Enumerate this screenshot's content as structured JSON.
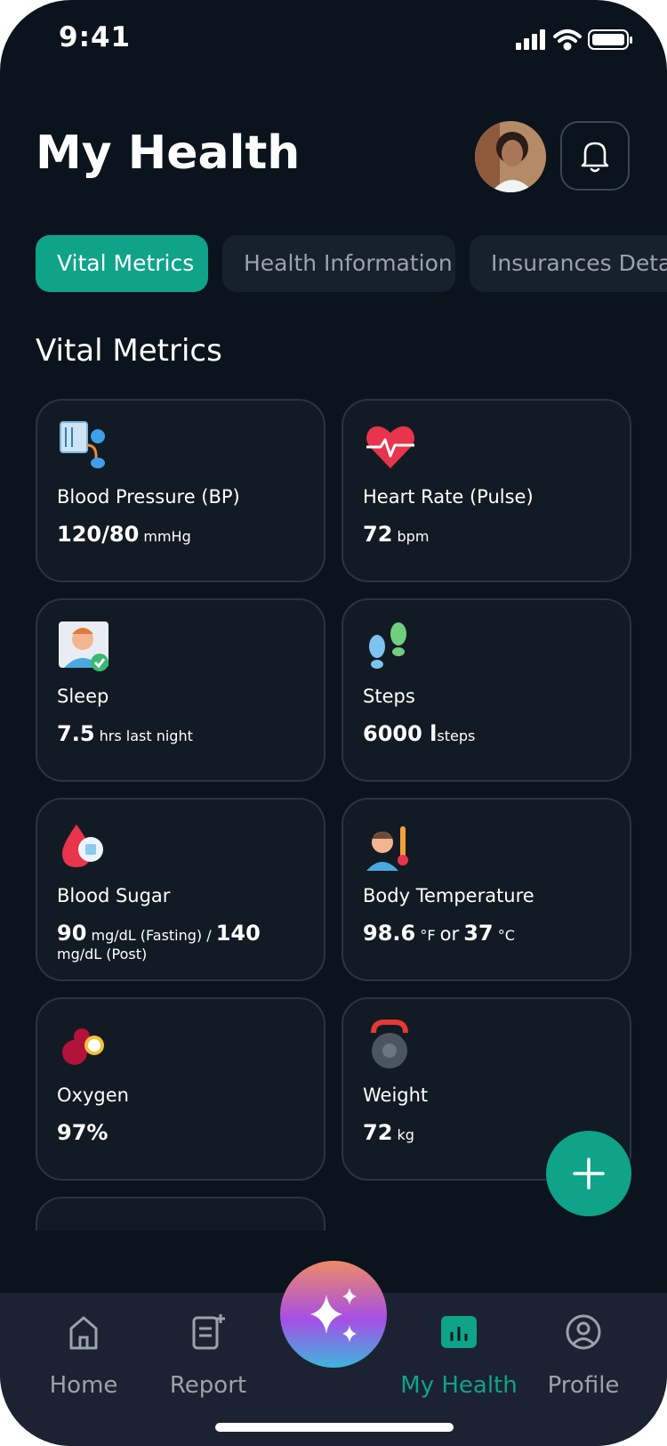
{
  "status": {
    "time": "9:41"
  },
  "header": {
    "title": "My Health"
  },
  "tabs": [
    {
      "label": "Vital Metrics",
      "active": true
    },
    {
      "label": "Health Information",
      "active": false
    },
    {
      "label": "Insurances Details",
      "active": false
    }
  ],
  "section": {
    "title": "Vital Metrics"
  },
  "cards": [
    {
      "icon": "blood-pressure-icon",
      "label": "Blood Pressure (BP)",
      "v1": "120/80",
      "u1": "mmHg"
    },
    {
      "icon": "heart-rate-icon",
      "label": "Heart Rate (Pulse)",
      "v1": "72",
      "u1": "bpm"
    },
    {
      "icon": "sleep-icon",
      "label": "Sleep",
      "v1": "7.5",
      "u1": "hrs last night"
    },
    {
      "icon": "steps-icon",
      "label": "Steps",
      "v1": "6000 l",
      "u1": "steps"
    },
    {
      "icon": "blood-sugar-icon",
      "label": "Blood Sugar",
      "v1": "90",
      "u1": "mg/dL (Fasting) /",
      "v2": "140",
      "u2": "mg/dL (Post)"
    },
    {
      "icon": "body-temperature-icon",
      "label": "Body Temperature",
      "v1": "98.6",
      "u1": "°F",
      "mid": "or",
      "v2": "37",
      "u2": "°C"
    },
    {
      "icon": "oxygen-icon",
      "label": "Oxygen",
      "v1": "97%",
      "u1": ""
    },
    {
      "icon": "weight-icon",
      "label": "Weight",
      "v1": "72",
      "u1": "kg"
    }
  ],
  "nav": {
    "items": [
      {
        "label": "Home",
        "icon": "home-icon"
      },
      {
        "label": "Report",
        "icon": "report-icon"
      },
      {
        "label": "My Health",
        "icon": "my-health-icon",
        "active": true
      },
      {
        "label": "Profile",
        "icon": "profile-icon"
      }
    ],
    "center_icon": "sparkle-icon"
  },
  "colors": {
    "accent": "#0fa38a",
    "background": "#0b141c",
    "card": "#121b24",
    "nav": "#1c2231"
  }
}
